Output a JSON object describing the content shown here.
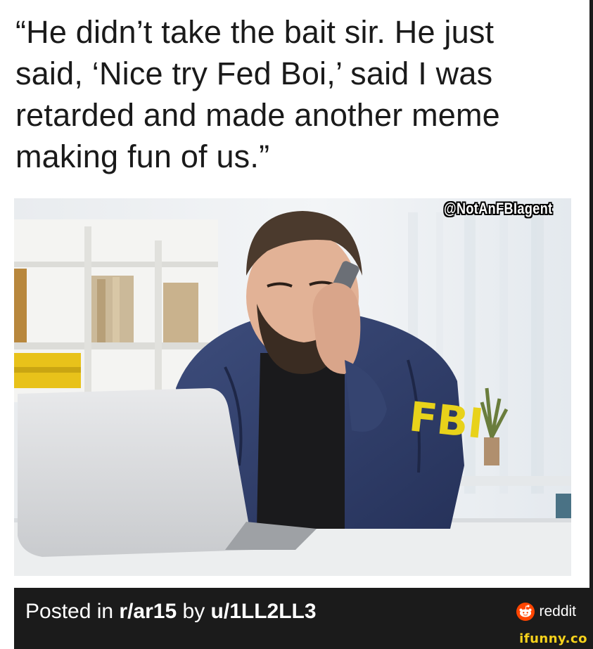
{
  "caption": {
    "line1": "“He didn’t take the bait sir. He just",
    "line2": "said, ‘Nice try Fed Boi,’ said I was",
    "line3": "retarded and made another meme",
    "line4": "making fun of us.”"
  },
  "image": {
    "watermark": "@NotAnFBIagent",
    "jacket_text": "FBI"
  },
  "footer": {
    "posted_prefix": "Posted in ",
    "subreddit": "r/ar15",
    "by_text": " by ",
    "user": "u/1LL2LL3",
    "platform": "reddit"
  },
  "branding": {
    "site": "ifunny.co"
  },
  "colors": {
    "footer_bg": "#1b1b1b",
    "reddit_orange": "#ff4500",
    "ifunny_yellow": "#f7d21c",
    "fbi_yellow": "#e8d21a"
  }
}
